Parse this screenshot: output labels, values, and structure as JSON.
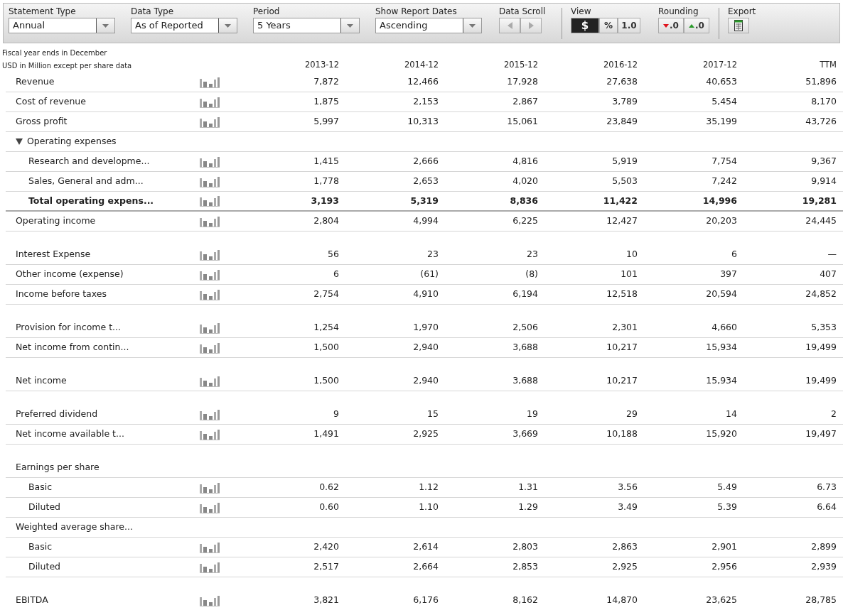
{
  "toolbar": {
    "dropdowns": [
      {
        "label": "Statement Type",
        "value": "Annual"
      },
      {
        "label": "Data Type",
        "value": "As of Reported"
      },
      {
        "label": "Period",
        "value": "5 Years"
      },
      {
        "label": "Show Report Dates",
        "value": "Ascending"
      }
    ],
    "data_scroll": {
      "label": "Data Scroll",
      "disabled": true
    },
    "view": {
      "label": "View",
      "options": [
        {
          "text": "$",
          "selected": true
        },
        {
          "text": "%",
          "selected": false
        },
        {
          "text": "1.0",
          "selected": false
        }
      ]
    },
    "rounding": {
      "label": "Rounding",
      "options": [
        {
          "text": ".0",
          "kind": "down"
        },
        {
          "text": ".0",
          "kind": "up"
        }
      ]
    },
    "export": {
      "label": "Export"
    }
  },
  "table": {
    "notes": [
      "Fiscal year ends in December",
      "USD in Million except per share data"
    ],
    "columns": [
      "2013-12",
      "2014-12",
      "2015-12",
      "2016-12",
      "2017-12",
      "TTM"
    ],
    "rows": [
      {
        "kind": "line",
        "label": "Revenue",
        "values": [
          "7,872",
          "12,466",
          "17,928",
          "27,638",
          "40,653",
          "51,896"
        ]
      },
      {
        "kind": "line",
        "label": "Cost of revenue",
        "values": [
          "1,875",
          "2,153",
          "2,867",
          "3,789",
          "5,454",
          "8,170"
        ]
      },
      {
        "kind": "line",
        "label": "Gross profit",
        "values": [
          "5,997",
          "10,313",
          "15,061",
          "23,849",
          "35,199",
          "43,726"
        ]
      },
      {
        "kind": "group",
        "label": "Operating expenses",
        "expanded": true,
        "children": [
          {
            "kind": "line",
            "label": "Research and developme...",
            "values": [
              "1,415",
              "2,666",
              "4,816",
              "5,919",
              "7,754",
              "9,367"
            ]
          },
          {
            "kind": "line",
            "label": "Sales, General and adm...",
            "values": [
              "1,778",
              "2,653",
              "4,020",
              "5,503",
              "7,242",
              "9,914"
            ]
          },
          {
            "kind": "total",
            "label": "Total operating expens...",
            "values": [
              "3,193",
              "5,319",
              "8,836",
              "11,422",
              "14,996",
              "19,281"
            ]
          }
        ]
      },
      {
        "kind": "line",
        "label": "Operating income",
        "values": [
          "2,804",
          "4,994",
          "6,225",
          "12,427",
          "20,203",
          "24,445"
        ]
      },
      {
        "kind": "line",
        "label": "Interest Expense",
        "gap_before": true,
        "values": [
          "56",
          "23",
          "23",
          "10",
          "6",
          "—"
        ]
      },
      {
        "kind": "line",
        "label": "Other income (expense)",
        "values": [
          "6",
          "(61)",
          "(8)",
          "101",
          "397",
          "407"
        ]
      },
      {
        "kind": "line",
        "label": "Income before taxes",
        "values": [
          "2,754",
          "4,910",
          "6,194",
          "12,518",
          "20,594",
          "24,852"
        ]
      },
      {
        "kind": "line",
        "label": "Provision for income t...",
        "gap_before": true,
        "values": [
          "1,254",
          "1,970",
          "2,506",
          "2,301",
          "4,660",
          "5,353"
        ]
      },
      {
        "kind": "line",
        "label": "Net income from contin...",
        "values": [
          "1,500",
          "2,940",
          "3,688",
          "10,217",
          "15,934",
          "19,499"
        ]
      },
      {
        "kind": "line",
        "label": "Net income",
        "gap_before": true,
        "values": [
          "1,500",
          "2,940",
          "3,688",
          "10,217",
          "15,934",
          "19,499"
        ]
      },
      {
        "kind": "line",
        "label": "Preferred dividend",
        "gap_before": true,
        "values": [
          "9",
          "15",
          "19",
          "29",
          "14",
          "2"
        ]
      },
      {
        "kind": "line",
        "label": "Net income available t...",
        "values": [
          "1,491",
          "2,925",
          "3,669",
          "10,188",
          "15,920",
          "19,497"
        ]
      },
      {
        "kind": "group",
        "label": "Earnings per share",
        "gap_before": true,
        "children": [
          {
            "kind": "line",
            "label": "Basic",
            "values": [
              "0.62",
              "1.12",
              "1.31",
              "3.56",
              "5.49",
              "6.73"
            ]
          },
          {
            "kind": "line",
            "label": "Diluted",
            "values": [
              "0.60",
              "1.10",
              "1.29",
              "3.49",
              "5.39",
              "6.64"
            ]
          }
        ]
      },
      {
        "kind": "group",
        "label": "Weighted average share...",
        "children": [
          {
            "kind": "line",
            "label": "Basic",
            "values": [
              "2,420",
              "2,614",
              "2,803",
              "2,863",
              "2,901",
              "2,899"
            ]
          },
          {
            "kind": "line",
            "label": "Diluted",
            "values": [
              "2,517",
              "2,664",
              "2,853",
              "2,925",
              "2,956",
              "2,939"
            ]
          }
        ]
      },
      {
        "kind": "line",
        "label": "EBITDA",
        "gap_before": true,
        "values": [
          "3,821",
          "6,176",
          "8,162",
          "14,870",
          "23,625",
          "28,785"
        ]
      }
    ]
  }
}
